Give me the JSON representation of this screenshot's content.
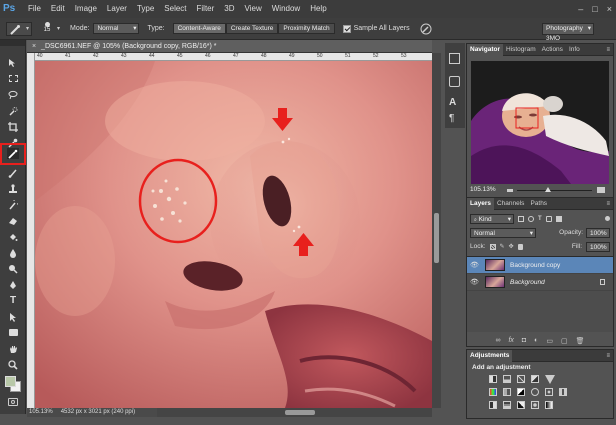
{
  "app": {
    "logo": "Ps",
    "window_controls": [
      "–",
      "□",
      "×"
    ]
  },
  "menu": [
    "File",
    "Edit",
    "Image",
    "Layer",
    "Type",
    "Select",
    "Filter",
    "3D",
    "View",
    "Window",
    "Help"
  ],
  "options": {
    "brush_size": "15",
    "mode_label": "Mode:",
    "mode_value": "Normal",
    "type_label": "Type:",
    "type_buttons": [
      "Content-Aware",
      "Create Texture",
      "Proximity Match"
    ],
    "sample_all_label": "Sample All Layers",
    "workspace": "Photography 3MO"
  },
  "document": {
    "tab_title": "_DSC6961.NEF @ 105% (Background copy, RGB/16*) *",
    "ruler_marks": [
      "40",
      "41",
      "42",
      "43",
      "44",
      "45",
      "46",
      "47",
      "48",
      "49",
      "50",
      "51",
      "52",
      "53"
    ],
    "status_zoom": "105.13%",
    "status_info": "4532 px x 3021 px (240 ppi)"
  },
  "navigator": {
    "tabs": [
      "Navigator",
      "Histogram",
      "Actions",
      "Info"
    ],
    "zoom": "105.13%"
  },
  "layers": {
    "tabs": [
      "Layers",
      "Channels",
      "Paths"
    ],
    "kind_label": "Kind",
    "blend_mode": "Normal",
    "opacity_label": "Opacity:",
    "opacity": "100%",
    "lock_label": "Lock:",
    "fill_label": "Fill:",
    "fill": "100%",
    "items": [
      {
        "name": "Background copy",
        "selected": true
      },
      {
        "name": "Background",
        "selected": false
      }
    ]
  },
  "adjustments": {
    "tab": "Adjustments",
    "heading": "Add an adjustment"
  },
  "colors": {
    "accent": "#e8201d",
    "selection": "#5b86b8"
  }
}
